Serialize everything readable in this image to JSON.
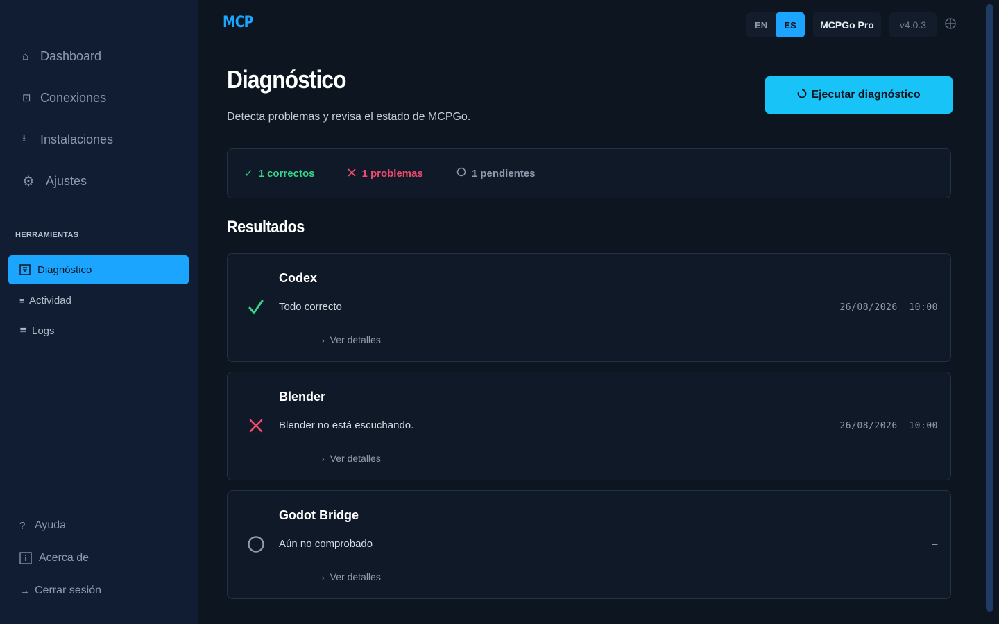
{
  "sidebar": {
    "main": [
      {
        "icon": "home-icon",
        "glyph": "⌂",
        "label": "Dashboard"
      },
      {
        "icon": "connections-icon",
        "glyph": "⊡",
        "label": "Conexiones"
      },
      {
        "icon": "download-icon",
        "glyph": "⭳",
        "label": "Instalaciones"
      },
      {
        "icon": "gear-icon",
        "glyph": "⚙",
        "label": "Ajustes"
      }
    ],
    "tools_title": "HERRAMIENTAS",
    "tools": [
      {
        "icon": "diagnostic-icon",
        "glyph": "▣",
        "label": "Diagnóstico",
        "active": true
      },
      {
        "icon": "activity-icon",
        "glyph": "≡",
        "label": "Actividad"
      },
      {
        "icon": "logs-icon",
        "glyph": "≣",
        "label": "Logs"
      }
    ],
    "bottom": [
      {
        "icon": "help-icon",
        "glyph": "?",
        "label": "Ayuda"
      },
      {
        "icon": "info-icon",
        "glyph": "ⓘ",
        "label": "Acerca de"
      },
      {
        "icon": "logout-icon",
        "glyph": "→",
        "label": "Cerrar sesión"
      }
    ]
  },
  "header": {
    "logo": "MCP",
    "lang_en": "EN",
    "lang_es": "ES",
    "lang_selected": "ES",
    "plan": "MCPGo Pro",
    "version": "v4.0.3",
    "globe_icon": "globe-icon"
  },
  "page": {
    "title": "Diagnóstico",
    "subtitle": "Detecta problemas y revisa el estado de MCPGo.",
    "run_button": "Ejecutar diagnóstico",
    "run_icon": "refresh-icon"
  },
  "summary": {
    "ok": "1 correctos",
    "bad": "1 problemas",
    "pending": "1 pendientes"
  },
  "results_title": "Resultados",
  "results": [
    {
      "name": "Codex",
      "status": "ok",
      "status_icon": "check-icon",
      "message": "Todo correcto",
      "time": "26/08/2026  10:00",
      "details": "Ver detalles"
    },
    {
      "name": "Blender",
      "status": "error",
      "status_icon": "x-icon",
      "message": "Blender no está escuchando.",
      "time": "26/08/2026  10:00",
      "details": "Ver detalles"
    },
    {
      "name": "Godot Bridge",
      "status": "pending",
      "status_icon": "circle-icon",
      "message": "Aún no comprobado",
      "time": "–",
      "details": "Ver detalles"
    }
  ],
  "colors": {
    "accent": "#1ba5ff",
    "button": "#17c3f7",
    "ok": "#35d489",
    "error": "#f04a6c",
    "pending": "#8f9bad"
  }
}
